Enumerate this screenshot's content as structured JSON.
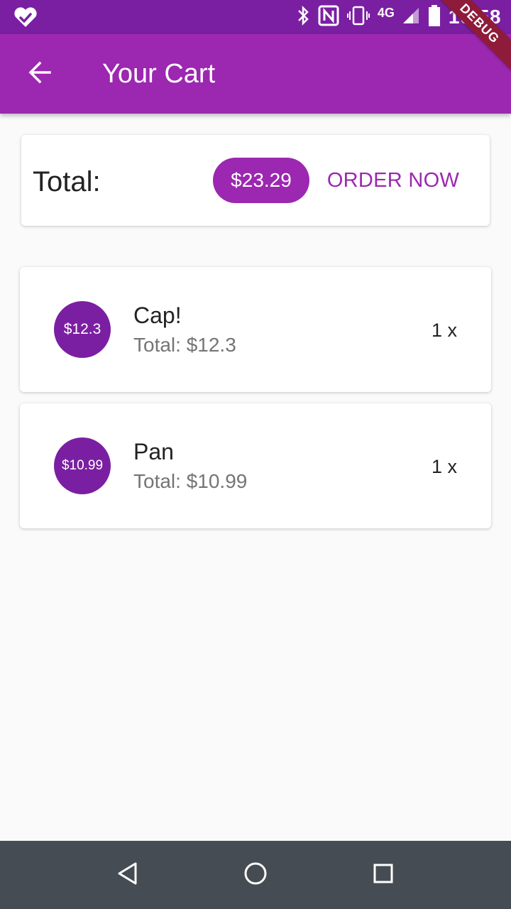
{
  "status_bar": {
    "network": "4G",
    "time": "10:58",
    "debug_banner": "DEBUG"
  },
  "app_bar": {
    "title": "Your Cart"
  },
  "summary": {
    "total_label": "Total:",
    "total_amount": "$23.29",
    "order_button": "ORDER NOW"
  },
  "cart_items": [
    {
      "price_badge": "$12.3",
      "title": "Cap!",
      "subtotal": "Total: $12.3",
      "quantity": "1 x"
    },
    {
      "price_badge": "$10.99",
      "title": "Pan",
      "subtotal": "Total: $10.99",
      "quantity": "1 x"
    }
  ],
  "icons": {
    "status_left": "heart-check-icon",
    "bluetooth": "bluetooth-icon",
    "nfc": "nfc-icon",
    "vibrate": "vibrate-icon",
    "signal": "signal-icon",
    "battery": "battery-icon",
    "back": "arrow-back-icon",
    "nav_back": "triangle-back-icon",
    "nav_home": "circle-home-icon",
    "nav_recents": "square-recents-icon"
  },
  "colors": {
    "status_bar": "#7b1fa2",
    "app_bar": "#9c27b0",
    "accent": "#9c27b0",
    "avatar": "#7b1fa2",
    "nav_bar": "#454c53",
    "background": "#fafafa"
  }
}
